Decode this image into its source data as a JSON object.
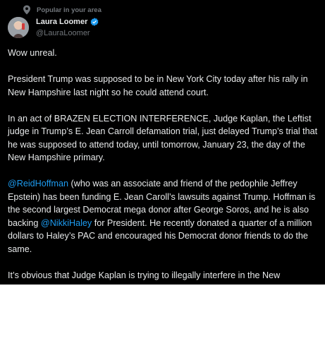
{
  "context": {
    "label": "Popular in your area",
    "icon": "location-pin-icon"
  },
  "author": {
    "name": "Laura Loomer",
    "handle": "@LauraLoomer",
    "verified": true,
    "badge_color": "#1d9bf0"
  },
  "tweet": {
    "p1": "Wow unreal.",
    "p2": "President Trump was supposed to be in New York City today after his rally in New Hampshire last night so he could attend court.",
    "p3": "In an act of BRAZEN ELECTION INTERFERENCE, Judge Kaplan, the Leftist judge in Trump’s E. Jean Carroll defamation trial, just delayed Trump’s trial that he was supposed to attend today, until tomorrow, January 23, the day of the New Hampshire primary.",
    "p4_mention1": "@ReidHoffman",
    "p4_text1": " (who was an associate and friend of the pedophile Jeffrey Epstein) has been funding E. Jean Caroll’s lawsuits against Trump. Hoffman is the second largest Democrat mega donor after George Soros, and he is also backing ",
    "p4_mention2": "@NikkiHaley",
    "p4_text2": " for President. He recently donated a quarter of a million dollars to Haley’s PAC and encouraged his Democrat donor friends to do the same.",
    "p5": "It’s obvious that Judge Kaplan is trying to illegally interfere in the New"
  },
  "colors": {
    "background": "#000000",
    "text": "#e7e9ea",
    "muted": "#71767b",
    "link": "#1d9bf0"
  }
}
